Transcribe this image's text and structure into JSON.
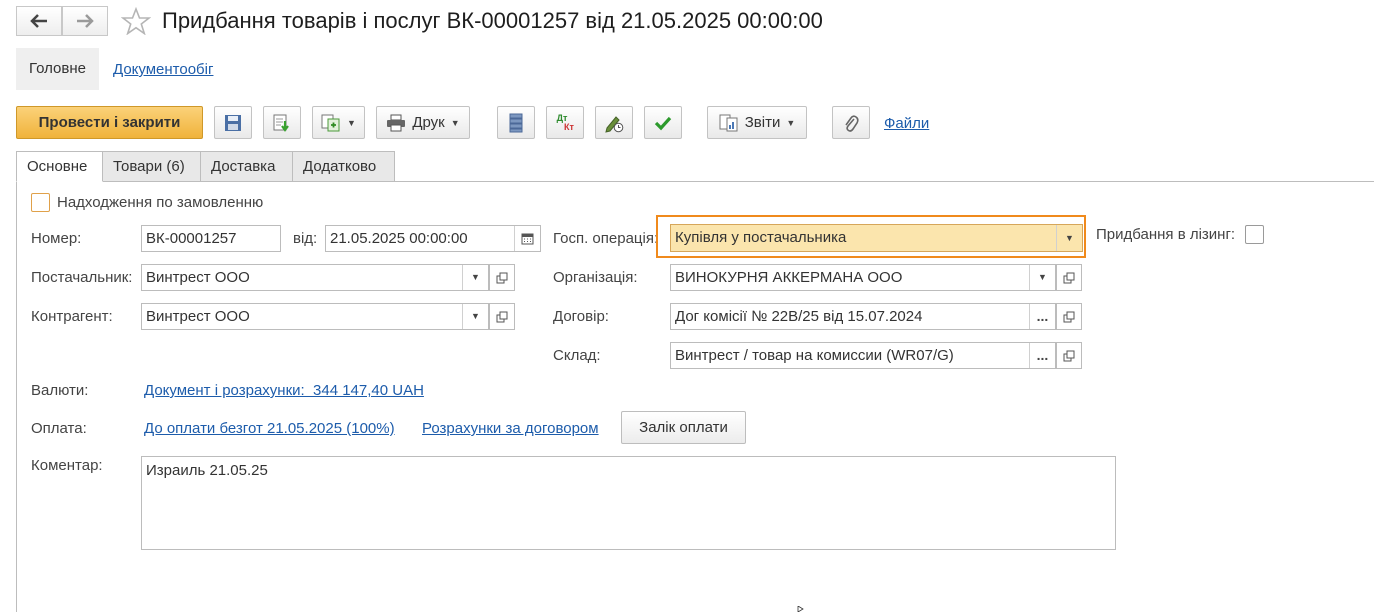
{
  "window": {
    "title": "Придбання товарів і послуг ВК-00001257 від 21.05.2025 00:00:00"
  },
  "sections": {
    "main": "Головне",
    "docflow": "Документообіг"
  },
  "toolbar": {
    "post_and_close": "Провести і закрити",
    "print": "Друк",
    "reports": "Звіти",
    "files": "Файли",
    "dtkt_top": "Дт",
    "dtkt_bottom": "Кт"
  },
  "tabs": [
    "Основне",
    "Товари (6)",
    "Доставка",
    "Додатково"
  ],
  "form": {
    "by_order_label": "Надходження по замовленню",
    "number_label": "Номер:",
    "number_value": "ВК-00001257",
    "date_label": "від:",
    "date_value": "21.05.2025 00:00:00",
    "operation_label": "Госп. операція:",
    "operation_value": "Купівля у постачальника",
    "leasing_label": "Придбання в лізинг:",
    "supplier_label": "Постачальник:",
    "supplier_value": "Винтрест ООО",
    "organization_label": "Організація:",
    "organization_value": "ВИНОКУРНЯ АККЕРМАНА ООО",
    "counterparty_label": "Контрагент:",
    "counterparty_value": "Винтрест ООО",
    "contract_label": "Договір:",
    "contract_value": "Дог комісії № 22В/25 від 15.07.2024",
    "warehouse_label": "Склад:",
    "warehouse_value": "Винтрест / товар на комиссии (WR07/G)",
    "currency_label": "Валюти:",
    "currency_link": "Документ і розрахунки:  344 147,40 UAH",
    "payment_label": "Оплата:",
    "payment_link": "До оплати безгот 21.05.2025 (100%)",
    "settlements_link": "Розрахунки за договором",
    "offset_button": "Залік оплати",
    "comment_label": "Коментар:",
    "comment_value": "Израиль 21.05.25"
  },
  "colors": {
    "accent_orange": "#f0b33b",
    "highlight_field": "#fbe5ad",
    "focus_border": "#f08a1c",
    "link_blue": "#1d5cab"
  }
}
